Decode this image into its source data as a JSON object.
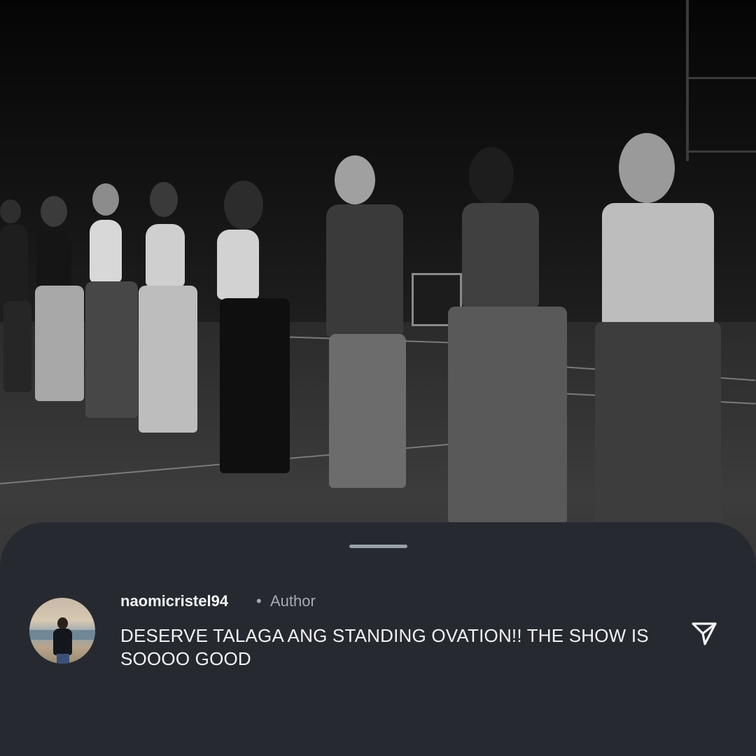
{
  "comment_sheet": {
    "comment": {
      "username": "naomicristel94",
      "separator": "•",
      "role_badge": "Author",
      "text": "DESERVE TALAGA ANG STANDING OVATION!! THE SHOW IS SOOOO GOOD"
    },
    "icons": {
      "avatar": "user-avatar-beach-photo",
      "action": "share-send-icon"
    }
  },
  "colors": {
    "sheet_background": "#262a30",
    "primary_text": "#f2f3f5",
    "secondary_text": "#a6abb3",
    "grabber": "#9aa0a8"
  }
}
